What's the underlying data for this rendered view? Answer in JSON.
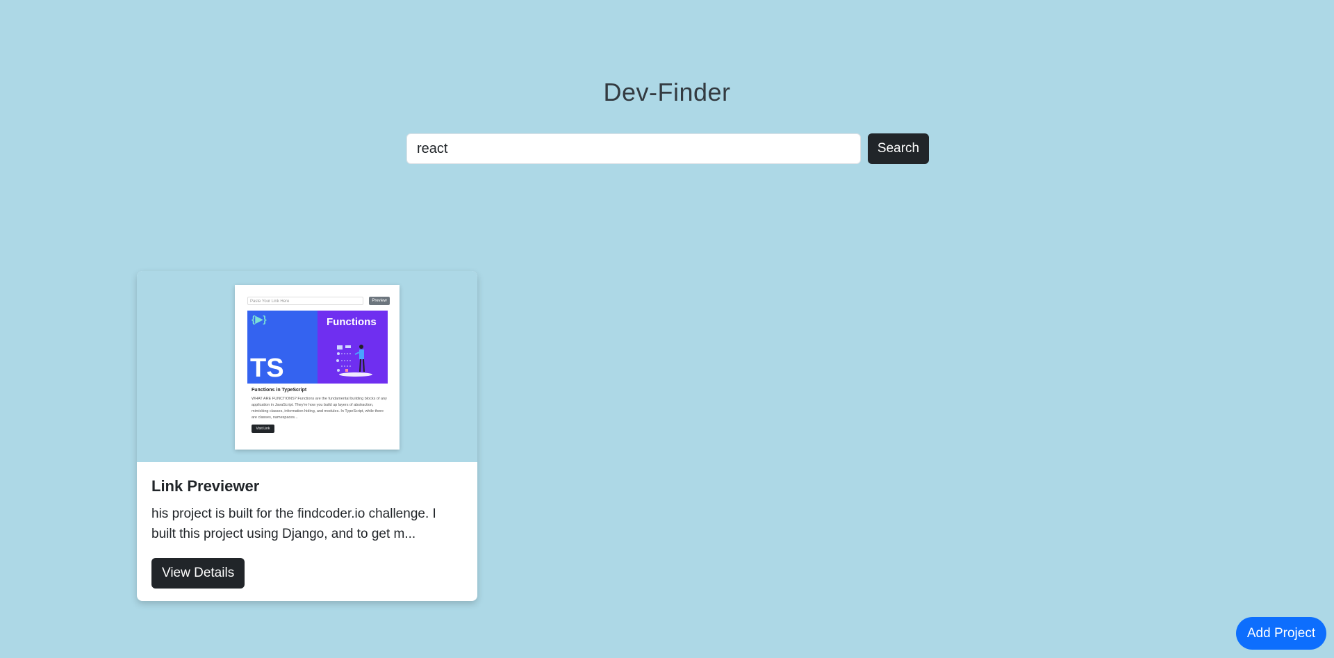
{
  "app": {
    "title": "Dev-Finder"
  },
  "search": {
    "value": "react",
    "button_label": "Search"
  },
  "projects": [
    {
      "title": "Link Previewer",
      "description": "his project is built for the findcoder.io challenge. I built this project using Django, and to get m...",
      "button_label": "View Details",
      "thumbnail": {
        "input_placeholder": "Paste Your Link Here",
        "preview_label": "Preview",
        "banner_logo": "{▶}",
        "banner_left_text": "TS",
        "banner_right_text": "Functions",
        "card_title": "Functions in TypeScript",
        "card_desc": "WHAT ARE FUNCTIONS? Functions are the fundamental building blocks of any application in JavaScript. They're how you build up layers of abstraction, mimicking classes, information hiding, and modules. In TypeScript, while there are classes, namespaces...",
        "visit_label": "Visit Link"
      }
    }
  ],
  "fab": {
    "label": "Add Project"
  },
  "colors": {
    "background": "#add8e6",
    "dark_button": "#212529",
    "primary": "#0d6efd"
  }
}
